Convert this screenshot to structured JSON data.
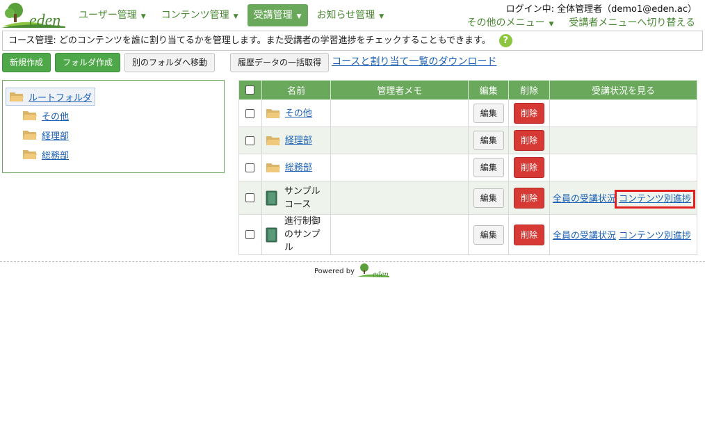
{
  "header": {
    "logo_text": "eden",
    "nav": [
      {
        "label": "ユーザー管理"
      },
      {
        "label": "コンテンツ管理"
      },
      {
        "label": "受講管理"
      },
      {
        "label": "お知らせ管理"
      }
    ],
    "login_text": "ログイン中: 全体管理者（demo1@eden.ac）",
    "other_menu": "その他のメニュー",
    "switch_menu": "受講者メニューへ切り替える"
  },
  "info": {
    "text": "コース管理: どのコンテンツを誰に割り当てるかを管理します。また受講者の学習進捗をチェックすることもできます。",
    "help_icon": "?"
  },
  "toolbar": {
    "new_label": "新規作成",
    "folder_label": "フォルダ作成",
    "move_label": "別のフォルダへ移動",
    "history_label": "履歴データの一括取得",
    "download_link": "コースと割り当て一覧のダウンロード"
  },
  "tree": {
    "root": "ルートフォルダ",
    "children": [
      "その他",
      "経理部",
      "総務部"
    ]
  },
  "table": {
    "headers": {
      "name": "名前",
      "memo": "管理者メモ",
      "edit": "編集",
      "delete": "削除",
      "status": "受講状況を見る"
    },
    "edit_label": "編集",
    "delete_label": "削除",
    "all_status_label": "全員の受講状況",
    "content_progress_label": "コンテンツ別進捗",
    "rows": [
      {
        "name": "その他",
        "kind": "folder"
      },
      {
        "name": "経理部",
        "kind": "folder"
      },
      {
        "name": "総務部",
        "kind": "folder"
      },
      {
        "name": "サンプルコース",
        "line1": "サンプル",
        "line2": "コース",
        "kind": "course"
      },
      {
        "name": "進行制御のサンプル",
        "line1": "進行制御",
        "line2": "のサンプル",
        "kind": "course"
      }
    ]
  },
  "footer": {
    "powered_by": "Powered by",
    "logo_text": "eden"
  },
  "colors": {
    "brand_green": "#6aa85c",
    "link": "#1a5fb4",
    "delete_red": "#d73a35",
    "highlight_red": "#e02020"
  }
}
